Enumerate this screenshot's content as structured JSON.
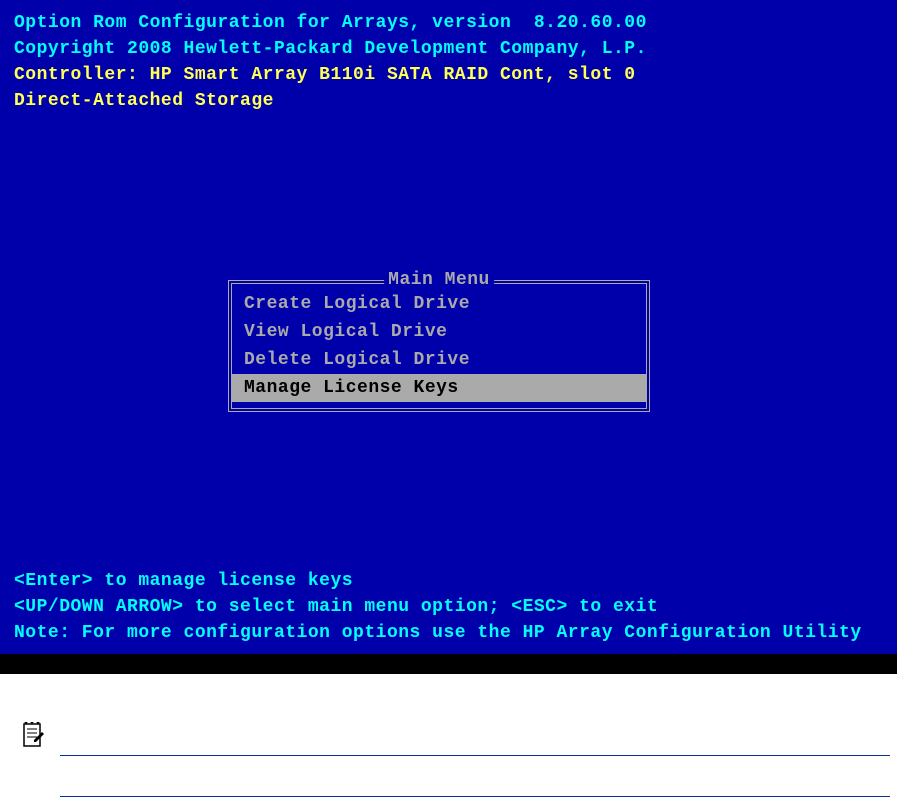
{
  "header": {
    "line1": "Option Rom Configuration for Arrays, version  8.20.60.00",
    "line2": "Copyright 2008 Hewlett-Packard Development Company, L.P.",
    "line3": "Controller: HP Smart Array B110i SATA RAID Cont, slot 0",
    "line4": "Direct-Attached Storage"
  },
  "menu": {
    "title": "Main Menu",
    "items": [
      {
        "label": "Create Logical Drive",
        "selected": false
      },
      {
        "label": "View Logical Drive",
        "selected": false
      },
      {
        "label": "Delete Logical Drive",
        "selected": false
      },
      {
        "label": "Manage License Keys",
        "selected": true
      }
    ]
  },
  "footer": {
    "line1": "<Enter> to manage license keys",
    "line2": "<UP/DOWN ARROW> to select main menu option; <ESC> to exit",
    "line3": "Note: For more configuration options use the HP Array Configuration Utility"
  }
}
